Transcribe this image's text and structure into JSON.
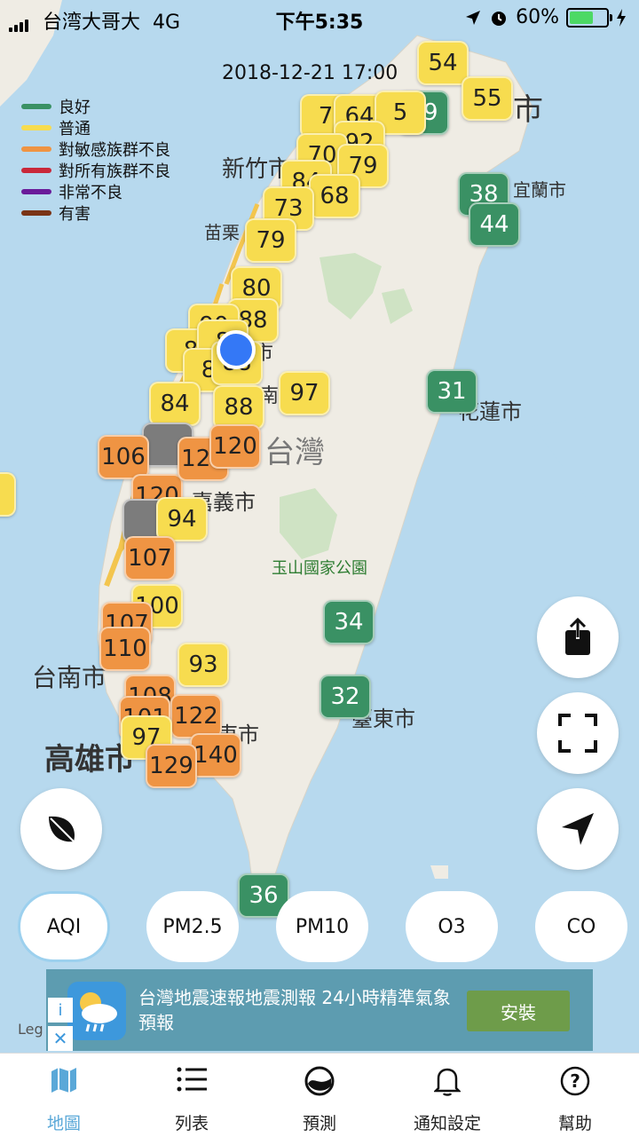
{
  "status_bar": {
    "carrier": "台湾大哥大",
    "network": "4G",
    "time": "下午5:35",
    "battery": "60%",
    "battery_level": 0.6
  },
  "map": {
    "timestamp": "2018-12-21 17:00",
    "legend": [
      {
        "label": "良好",
        "color": "#3a9164"
      },
      {
        "label": "普通",
        "color": "#f7dc4f"
      },
      {
        "label": "對敏感族群不良",
        "color": "#ef9443"
      },
      {
        "label": "對所有族群不良",
        "color": "#c9283a"
      },
      {
        "label": "非常不良",
        "color": "#6a1b9a"
      },
      {
        "label": "有害",
        "color": "#7a3416"
      }
    ],
    "cities": {
      "hsinchu": "新竹市",
      "miaoli": "苗栗",
      "yilan": "宜蘭市",
      "hualien": "花蓮市",
      "taiwan": "台灣",
      "chiayi": "嘉義市",
      "yushan": "玉山國家公園",
      "tainan": "台南市",
      "taitung": "臺東市",
      "kaohsiung": "高雄市",
      "taipei_partial": "市",
      "taichung_a": "市",
      "taichung_b": "南投",
      "pingtung": "東市"
    },
    "markers": [
      {
        "value": "54",
        "level": "mod"
      },
      {
        "value": "55",
        "level": "mod"
      },
      {
        "value": "49",
        "level": "good"
      },
      {
        "value": "7",
        "level": "mod"
      },
      {
        "value": "64",
        "level": "mod"
      },
      {
        "value": "5",
        "level": "mod"
      },
      {
        "value": "92",
        "level": "mod"
      },
      {
        "value": "70",
        "level": "mod"
      },
      {
        "value": "79",
        "level": "mod"
      },
      {
        "value": "84",
        "level": "mod"
      },
      {
        "value": "68",
        "level": "mod"
      },
      {
        "value": "38",
        "level": "good"
      },
      {
        "value": "44",
        "level": "good"
      },
      {
        "value": "73",
        "level": "mod"
      },
      {
        "value": "79",
        "level": "mod"
      },
      {
        "value": "80",
        "level": "mod"
      },
      {
        "value": "88",
        "level": "mod"
      },
      {
        "value": "90",
        "level": "mod"
      },
      {
        "value": "8",
        "level": "mod"
      },
      {
        "value": "8",
        "level": "mod"
      },
      {
        "value": "8",
        "level": "mod"
      },
      {
        "value": "88",
        "level": "mod"
      },
      {
        "value": "97",
        "level": "mod"
      },
      {
        "value": "31",
        "level": "good"
      },
      {
        "value": "84",
        "level": "mod"
      },
      {
        "value": "88",
        "level": "mod"
      },
      {
        "value": "",
        "level": "na"
      },
      {
        "value": "106",
        "level": "usg"
      },
      {
        "value": "120",
        "level": "usg"
      },
      {
        "value": "125",
        "level": "usg"
      },
      {
        "value": "120",
        "level": "usg"
      },
      {
        "value": "",
        "level": "na"
      },
      {
        "value": "94",
        "level": "mod"
      },
      {
        "value": "107",
        "level": "usg"
      },
      {
        "value": "100",
        "level": "mod"
      },
      {
        "value": "107",
        "level": "usg"
      },
      {
        "value": "110",
        "level": "usg"
      },
      {
        "value": "34",
        "level": "good"
      },
      {
        "value": "93",
        "level": "mod"
      },
      {
        "value": "32",
        "level": "good"
      },
      {
        "value": "108",
        "level": "usg"
      },
      {
        "value": "122",
        "level": "usg"
      },
      {
        "value": "101",
        "level": "usg"
      },
      {
        "value": "97",
        "level": "mod"
      },
      {
        "value": "140",
        "level": "usg"
      },
      {
        "value": "129",
        "level": "usg"
      },
      {
        "value": "36",
        "level": "good"
      },
      {
        "value": "",
        "level": "mod"
      }
    ]
  },
  "buttons": {
    "share": "share-icon",
    "fullscreen": "fullscreen-icon",
    "locate": "location-arrow-icon",
    "leaf": "leaf-icon"
  },
  "pollutant_chips": [
    {
      "label": "AQI",
      "active": true
    },
    {
      "label": "PM2.5",
      "active": false
    },
    {
      "label": "PM10",
      "active": false
    },
    {
      "label": "O3",
      "active": false
    },
    {
      "label": "CO",
      "active": false
    }
  ],
  "ad": {
    "text": "台灣地震速報地震測報 24小時精準氣象預報",
    "install": "安裝",
    "info": "i",
    "close": "✕"
  },
  "legal": "Leg",
  "tabs": [
    {
      "label": "地圖",
      "icon": "map-icon",
      "active": true
    },
    {
      "label": "列表",
      "icon": "list-icon",
      "active": false
    },
    {
      "label": "預測",
      "icon": "forecast-icon",
      "active": false
    },
    {
      "label": "通知設定",
      "icon": "bell-icon",
      "active": false
    },
    {
      "label": "幫助",
      "icon": "help-icon",
      "active": false
    }
  ]
}
